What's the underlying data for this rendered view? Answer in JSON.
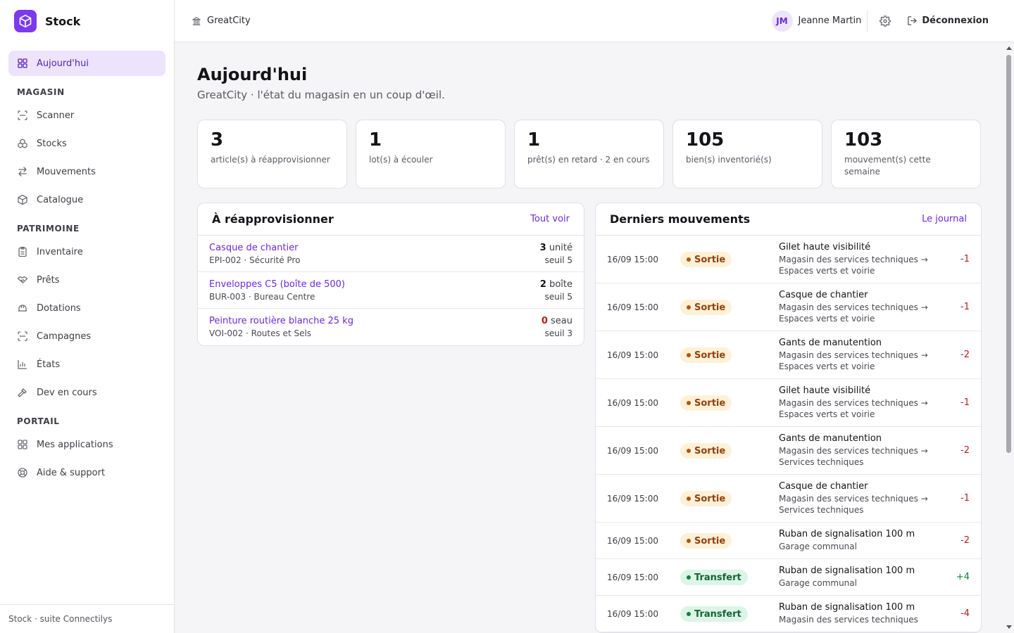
{
  "brand": {
    "name": "Stock"
  },
  "sidebar": {
    "top_item": {
      "label": "Aujourd'hui",
      "icon": "grid-icon"
    },
    "sections": [
      {
        "title": "MAGASIN",
        "items": [
          {
            "label": "Scanner",
            "icon": "scan-icon"
          },
          {
            "label": "Stocks",
            "icon": "boxes-icon"
          },
          {
            "label": "Mouvements",
            "icon": "arrows-icon"
          },
          {
            "label": "Catalogue",
            "icon": "package-icon"
          }
        ]
      },
      {
        "title": "PATRIMOINE",
        "items": [
          {
            "label": "Inventaire",
            "icon": "clipboard-icon"
          },
          {
            "label": "Prêts",
            "icon": "handshake-icon"
          },
          {
            "label": "Dotations",
            "icon": "helmet-icon"
          },
          {
            "label": "Campagnes",
            "icon": "scan-icon"
          },
          {
            "label": "États",
            "icon": "bar-chart-icon"
          },
          {
            "label": "Dev en cours",
            "icon": "hammer-icon"
          }
        ]
      },
      {
        "title": "PORTAIL",
        "items": [
          {
            "label": "Mes applications",
            "icon": "grid-icon"
          },
          {
            "label": "Aide & support",
            "icon": "lifebuoy-icon"
          }
        ]
      }
    ],
    "footer": "Stock · suite Connectilys"
  },
  "header": {
    "org": "GreatCity",
    "user_initials": "JM",
    "user_name": "Jeanne Martin",
    "logout": "Déconnexion"
  },
  "page": {
    "title": "Aujourd'hui",
    "subtitle": "GreatCity · l'état du magasin en un coup d'œil."
  },
  "kpis": [
    {
      "value": "3",
      "label": "article(s) à réapprovisionner"
    },
    {
      "value": "1",
      "label": "lot(s) à écouler"
    },
    {
      "value": "1",
      "label": "prêt(s) en retard · 2 en cours"
    },
    {
      "value": "105",
      "label": "bien(s) inventorié(s)"
    },
    {
      "value": "103",
      "label": "mouvement(s) cette semaine"
    }
  ],
  "restock": {
    "title": "À réapprovisionner",
    "link": "Tout voir",
    "rows": [
      {
        "name": "Casque de chantier",
        "meta": "EPI-002 · Sécurité Pro",
        "qty": "3",
        "unit": "unité",
        "seuil": "seuil 5"
      },
      {
        "name": "Enveloppes C5 (boîte de 500)",
        "meta": "BUR-003 · Bureau Centre",
        "qty": "2",
        "unit": "boîte",
        "seuil": "seuil 5"
      },
      {
        "name": "Peinture routière blanche 25 kg",
        "meta": "VOI-002 · Routes et Sels",
        "qty": "0",
        "unit": "seau",
        "seuil": "seuil 3"
      }
    ]
  },
  "movements": {
    "title": "Derniers mouvements",
    "link": "Le journal",
    "rows": [
      {
        "date": "16/09 15:00",
        "type": "Sortie",
        "item": "Gilet haute visibilité",
        "path": "Magasin des services techniques → Espaces verts et voirie",
        "delta": "-1"
      },
      {
        "date": "16/09 15:00",
        "type": "Sortie",
        "item": "Casque de chantier",
        "path": "Magasin des services techniques → Espaces verts et voirie",
        "delta": "-1"
      },
      {
        "date": "16/09 15:00",
        "type": "Sortie",
        "item": "Gants de manutention",
        "path": "Magasin des services techniques → Espaces verts et voirie",
        "delta": "-2"
      },
      {
        "date": "16/09 15:00",
        "type": "Sortie",
        "item": "Gilet haute visibilité",
        "path": "Magasin des services techniques → Espaces verts et voirie",
        "delta": "-1"
      },
      {
        "date": "16/09 15:00",
        "type": "Sortie",
        "item": "Gants de manutention",
        "path": "Magasin des services techniques → Services techniques",
        "delta": "-2"
      },
      {
        "date": "16/09 15:00",
        "type": "Sortie",
        "item": "Casque de chantier",
        "path": "Magasin des services techniques → Services techniques",
        "delta": "-1"
      },
      {
        "date": "16/09 15:00",
        "type": "Sortie",
        "item": "Ruban de signalisation 100 m",
        "path": "Garage communal",
        "delta": "-2"
      },
      {
        "date": "16/09 15:00",
        "type": "Transfert",
        "item": "Ruban de signalisation 100 m",
        "path": "Garage communal",
        "delta": "+4"
      },
      {
        "date": "16/09 15:00",
        "type": "Transfert",
        "item": "Ruban de signalisation 100 m",
        "path": "Magasin des services techniques",
        "delta": "-4"
      }
    ]
  },
  "colors": {
    "accent": "#7c3aed",
    "danger": "#b91c1c",
    "success": "#15803d"
  }
}
